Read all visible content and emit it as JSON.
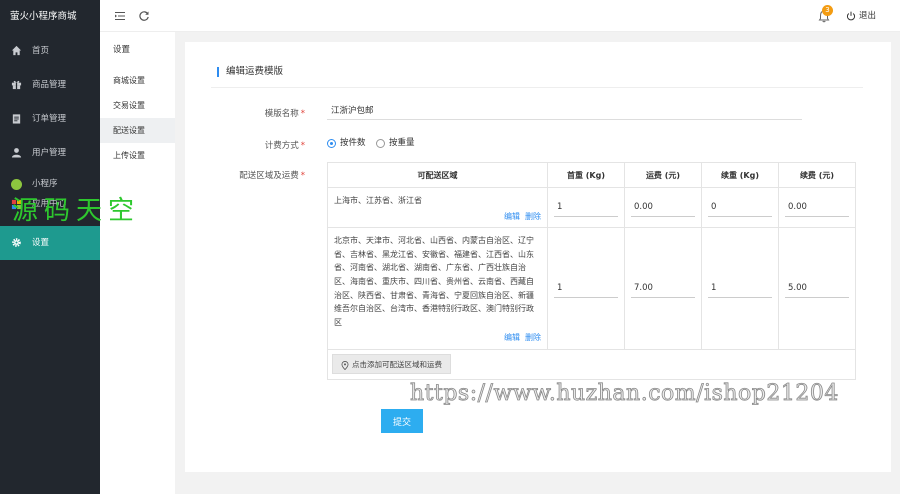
{
  "app": {
    "title": "萤火小程序商城"
  },
  "sidebar": {
    "items": [
      {
        "label": "首页",
        "icon": "home-icon"
      },
      {
        "label": "商品管理",
        "icon": "gift-icon"
      },
      {
        "label": "订单管理",
        "icon": "clipboard-icon"
      },
      {
        "label": "用户管理",
        "icon": "user-icon"
      },
      {
        "label": "小程序",
        "icon": "miniprogram-icon"
      },
      {
        "label": "应用中心",
        "icon": "apps-icon"
      },
      {
        "label": "设置",
        "icon": "gear-icon",
        "active": true
      }
    ]
  },
  "topbar": {
    "notification_count": "3",
    "logout_label": "退出"
  },
  "submenu": {
    "title": "设置",
    "items": [
      {
        "label": "商城设置"
      },
      {
        "label": "交易设置"
      },
      {
        "label": "配送设置",
        "active": true
      },
      {
        "label": "上传设置"
      }
    ]
  },
  "form": {
    "title": "编辑运费模版",
    "name_label": "模版名称",
    "name_value": "江浙沪包邮",
    "billing_label": "计费方式",
    "billing_options": [
      {
        "label": "按件数",
        "checked": true
      },
      {
        "label": "按重量",
        "checked": false
      }
    ],
    "area_label": "配送区域及运费",
    "required_mark": "*",
    "table": {
      "headers": [
        "可配送区域",
        "首重 (Kg)",
        "运费 (元)",
        "续重 (Kg)",
        "续费 (元)"
      ],
      "rows": [
        {
          "area": "上海市、江苏省、浙江省",
          "first_weight": "1",
          "first_fee": "0.00",
          "additional_weight": "0",
          "additional_fee": "0.00"
        },
        {
          "area": "北京市、天津市、河北省、山西省、内蒙古自治区、辽宁省、吉林省、黑龙江省、安徽省、福建省、江西省、山东省、河南省、湖北省、湖南省、广东省、广西壮族自治区、海南省、重庆市、四川省、贵州省、云南省、西藏自治区、陕西省、甘肃省、青海省、宁夏回族自治区、新疆维吾尔自治区、台湾市、香港特别行政区、澳门特别行政区",
          "first_weight": "1",
          "first_fee": "7.00",
          "additional_weight": "1",
          "additional_fee": "5.00"
        }
      ],
      "edit_label": "编辑",
      "delete_label": "删除",
      "add_label": "点击添加可配送区域和运费"
    },
    "submit_label": "提交"
  },
  "watermarks": {
    "cn": "源码天空",
    "url": "https://www.huzhan.com/ishop21204"
  },
  "colors": {
    "sidebar_bg": "#22272e",
    "active_teal": "#1e9a8f",
    "accent_blue": "#2d8cf0",
    "submit_blue": "#2dadf0",
    "required_red": "#e0433b",
    "badge_orange": "#f39c12"
  }
}
